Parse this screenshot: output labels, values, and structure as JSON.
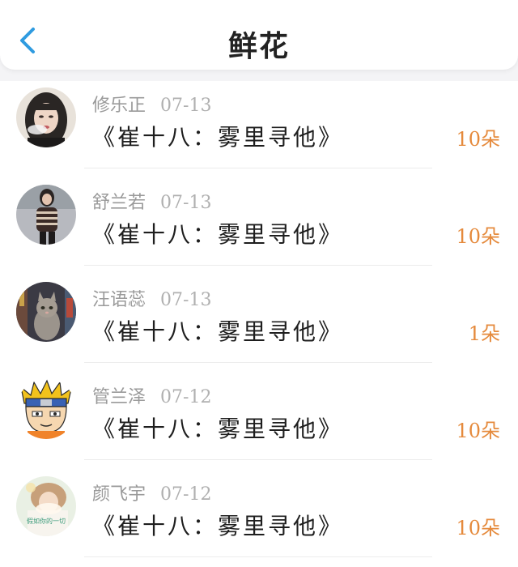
{
  "header": {
    "title": "鲜花",
    "back_icon": "chevron-left-icon",
    "accent": "#2f9be0"
  },
  "colors": {
    "count": "#e58a3c",
    "meta": "#9a9a9a"
  },
  "items": [
    {
      "name": "修乐正",
      "date": "07-13",
      "book": "《崔十八：雾里寻他》",
      "count": "10朵",
      "avatar": "avatar-woman-smoking"
    },
    {
      "name": "舒兰若",
      "date": "07-13",
      "book": "《崔十八：雾里寻他》",
      "count": "10朵",
      "avatar": "avatar-woman-striped-top"
    },
    {
      "name": "汪语蕊",
      "date": "07-13",
      "book": "《崔十八：雾里寻他》",
      "count": "1朵",
      "avatar": "avatar-cat"
    },
    {
      "name": "管兰泽",
      "date": "07-12",
      "book": "《崔十八：雾里寻他》",
      "count": "10朵",
      "avatar": "avatar-cartoon-ninja"
    },
    {
      "name": "颜飞宇",
      "date": "07-12",
      "book": "《崔十八：雾里寻他》",
      "count": "10朵",
      "avatar": "avatar-illustration-text",
      "avatar_text": "假如你的一切"
    }
  ]
}
